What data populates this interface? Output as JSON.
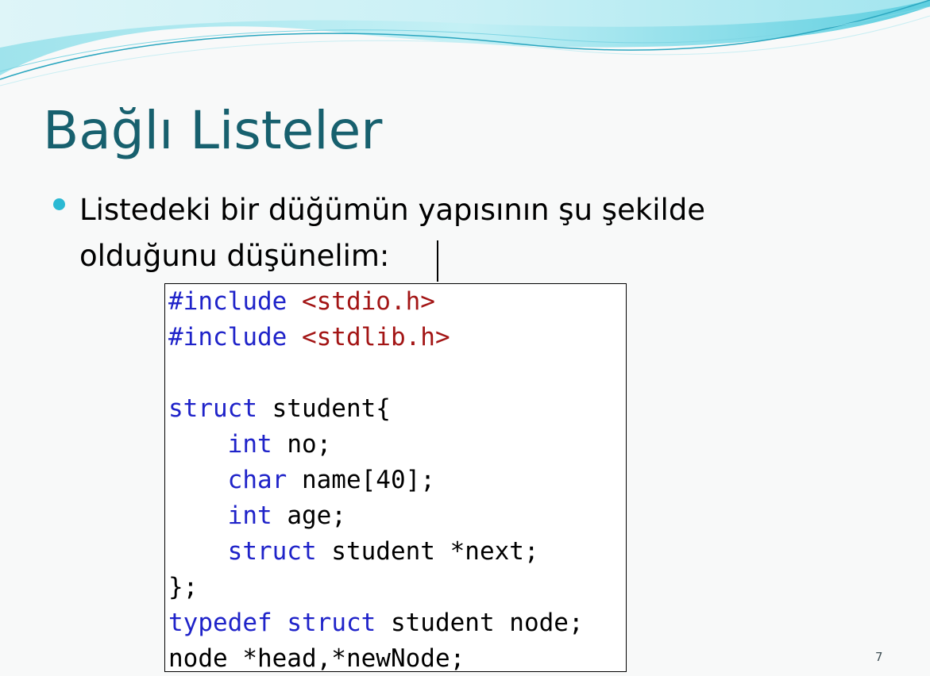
{
  "slide": {
    "title": "Bağlı Listeler",
    "bullet_line1": "Listedeki bir düğümün yapısının şu şekilde",
    "bullet_line2": "olduğunu düşünelim:",
    "page_number": "7"
  },
  "code": {
    "line1": {
      "directive": "#include",
      "header": "<stdio.h>"
    },
    "line2": {
      "directive": "#include",
      "header": "<stdlib.h>"
    },
    "line4": {
      "kw": "struct",
      "rest": " student{"
    },
    "line5": {
      "kw": "int",
      "rest": " no;"
    },
    "line6": {
      "kw": "char",
      "rest": " name[40];"
    },
    "line7": {
      "kw": "int",
      "rest": " age;"
    },
    "line8": {
      "kw": "struct",
      "rest": " student *next;"
    },
    "line9": {
      "text": "};"
    },
    "line10": {
      "kw1": "typedef",
      "kw2": "struct",
      "rest": " student node;"
    },
    "line11": {
      "text": "node *head,*newNode;"
    }
  },
  "colors": {
    "title": "#17606e",
    "bullet": "#2bb9d3",
    "keyword": "#1f23c9",
    "header_string": "#a31515"
  }
}
